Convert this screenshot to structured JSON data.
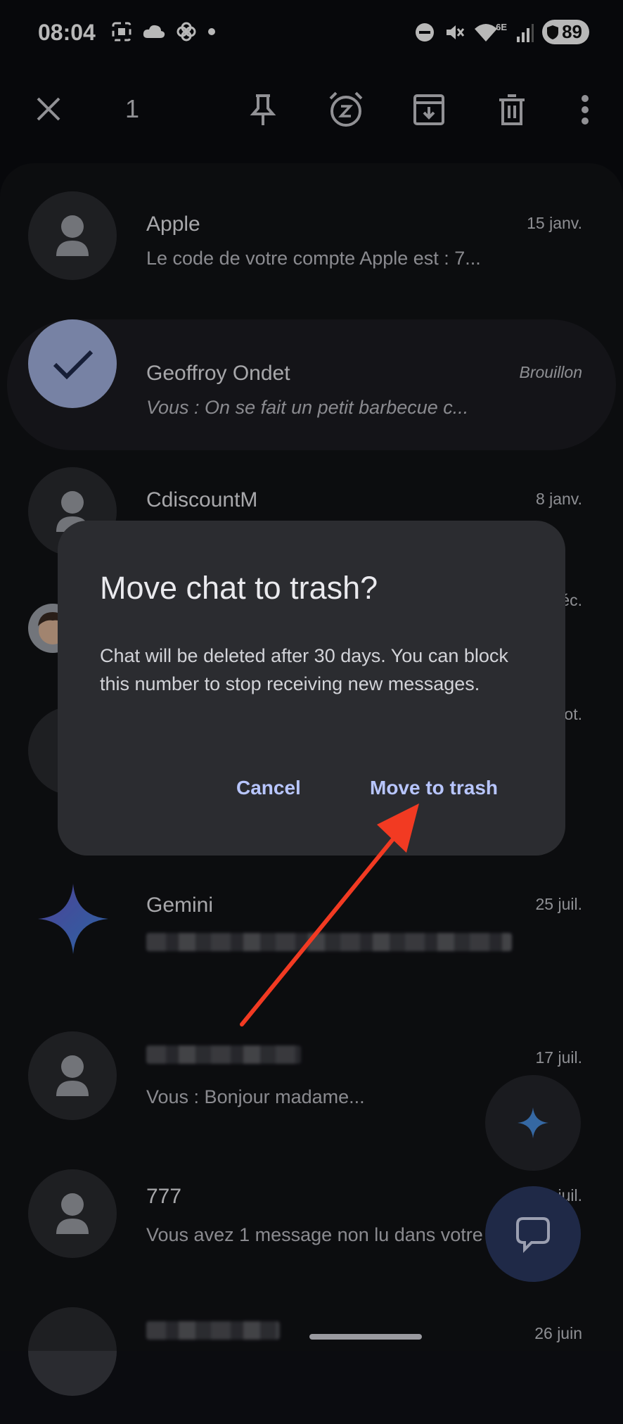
{
  "status_bar": {
    "time": "08:04",
    "battery": "89",
    "wifi_label": "6E",
    "icons_left": [
      "screenshot-icon",
      "cloud-icon",
      "pinwheel-icon",
      "dot-icon"
    ],
    "icons_right": [
      "dnd-icon",
      "mute-icon",
      "wifi-icon",
      "signal-icon",
      "battery-icon"
    ]
  },
  "toolbar": {
    "selected_count": "1",
    "icons": [
      "close-icon",
      "pin-icon",
      "snooze-icon",
      "archive-icon",
      "delete-icon",
      "more-icon"
    ]
  },
  "conversations": [
    {
      "name": "Apple",
      "snippet": "Le code de votre compte Apple est : 7...",
      "date": "15 janv.",
      "avatar": "person"
    },
    {
      "name": "Geoffroy Ondet",
      "snippet": "Vous : On se fait un petit barbecue c...",
      "date": "Brouillon",
      "avatar": "check",
      "selected": true
    },
    {
      "name": "CdiscountM",
      "snippet": "",
      "date": "8 janv.",
      "avatar": "person"
    },
    {
      "name": "",
      "snippet": "",
      "date": "éc.",
      "avatar": "memoji"
    },
    {
      "name": "",
      "snippet": "",
      "date": "ot.",
      "avatar": "person"
    },
    {
      "name": "Gemini",
      "snippet": "",
      "date": "25 juil.",
      "avatar": "gemini"
    },
    {
      "name": "",
      "snippet": "Vous : Bonjour madame...",
      "date": "17 juil.",
      "avatar": "person"
    },
    {
      "name": "777",
      "snippet": "Vous avez 1 message non lu dans votre",
      "date": "juil.",
      "avatar": "person"
    },
    {
      "name": "",
      "snippet": "",
      "date": "26 juin",
      "avatar": "person"
    }
  ],
  "dialog": {
    "title": "Move chat to trash?",
    "body": "Chat will be deleted after 30 days. You can block this number to stop receiving new messages.",
    "cancel_label": "Cancel",
    "confirm_label": "Move to trash"
  },
  "colors": {
    "background": "#0b0c10",
    "dialog": "#2b2c30",
    "accent": "#b8c6ff",
    "selected_avatar": "#a6b4e4",
    "annotation_arrow": "#f23a22"
  }
}
